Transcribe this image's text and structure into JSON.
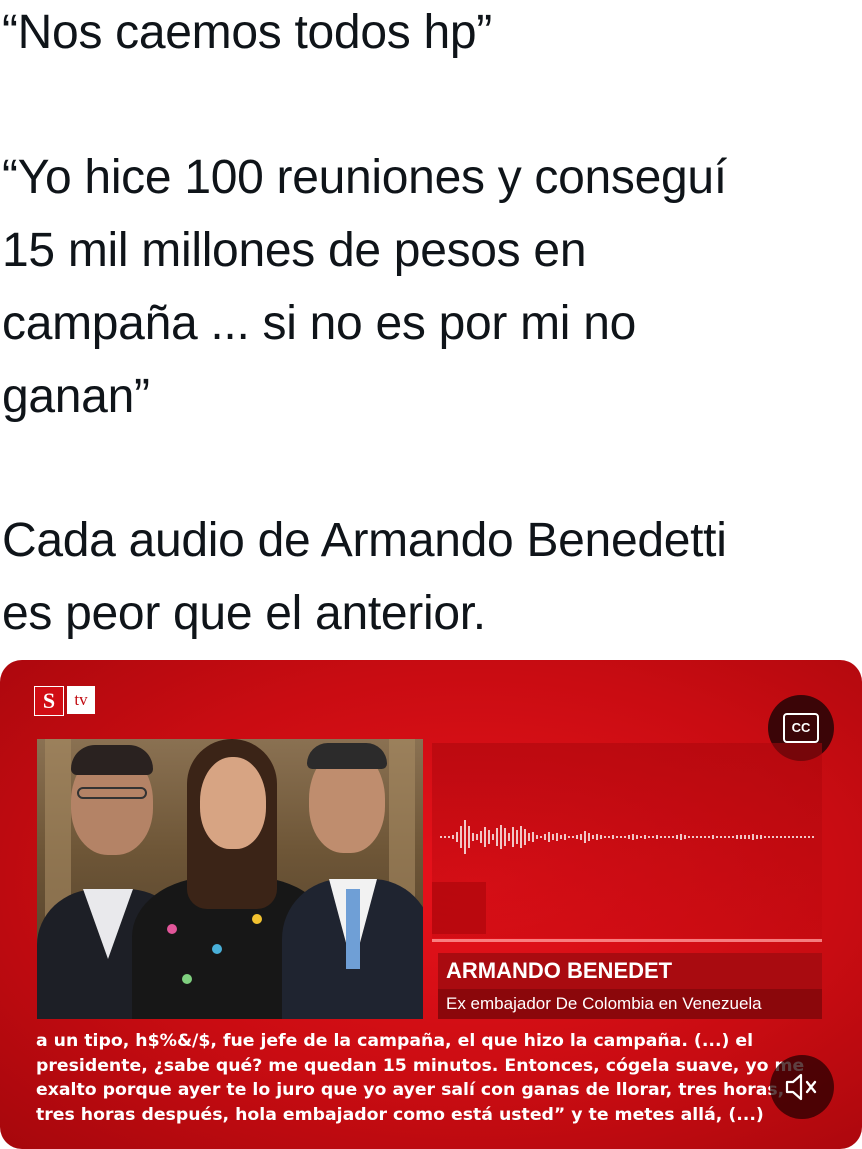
{
  "tweet": {
    "paragraph_1": "“Nos caemos todos hp”",
    "paragraph_2": "“Yo hice 100 reuniones y conseguí\n15 mil millones de pesos en\ncampaña ... si no es por mi no\nganan”",
    "paragraph_3": "Cada audio de Armando Benedetti\nes peor que el anterior."
  },
  "video": {
    "logo_s": "S",
    "logo_tv": "tv",
    "cc_label": "CC",
    "lower_third": {
      "name": "ARMANDO BENEDET",
      "role": "Ex embajador De Colombia en Venezuela"
    },
    "captions": [
      "a un tipo, h$%&/$, fue jefe de la campaña, el que hizo la campaña. (...) el",
      "presidente, ¿sabe qué? me quedan 15 minutos. Entonces, cógela suave, yo me",
      "exalto porque ayer te lo juro que yo ayer salí con ganas de llorar, tres horas,",
      "tres horas después, hola embajador como está usted” y te metes allá, (...)"
    ],
    "icons": {
      "cc": "closed-captions-icon",
      "mute": "volume-muted-icon"
    },
    "colors": {
      "background": "#d50f16",
      "lower_third_name": "#a90b10",
      "lower_third_role": "#8b070b"
    }
  }
}
